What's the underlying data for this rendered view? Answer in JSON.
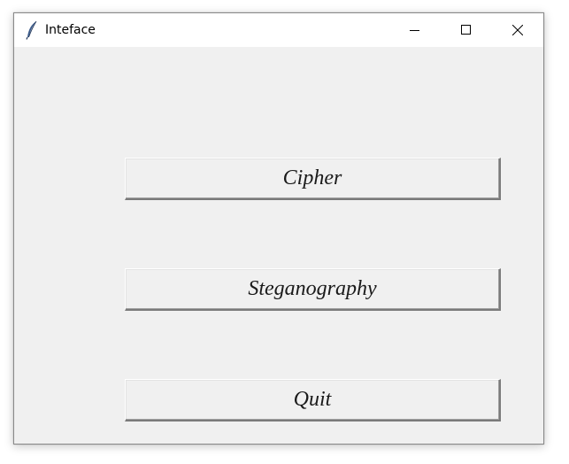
{
  "window": {
    "title": "Inteface",
    "app_icon": "feather-icon",
    "controls": {
      "minimize_icon": "minimize-icon",
      "maximize_icon": "maximize-icon",
      "close_icon": "close-icon"
    }
  },
  "buttons": {
    "cipher_label": "Cipher",
    "steganography_label": "Steganography",
    "quit_label": "Quit"
  }
}
